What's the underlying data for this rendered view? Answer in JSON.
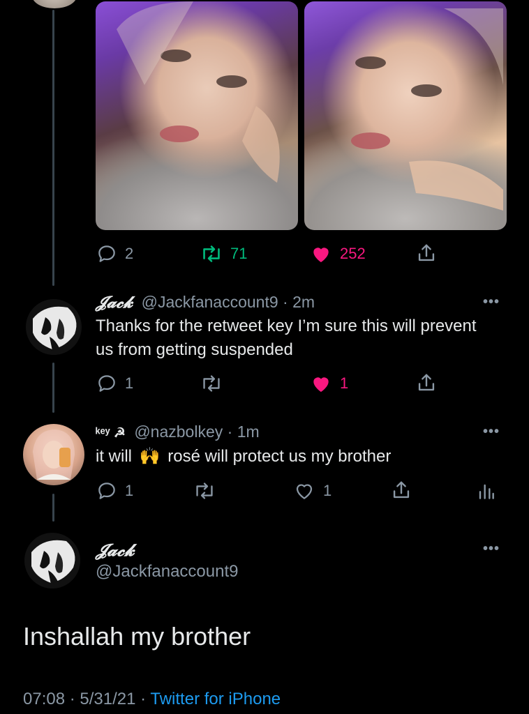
{
  "tweet1": {
    "reply_count": "2",
    "retweet_count": "71",
    "like_count": "252"
  },
  "reply1": {
    "display_name": "𝓙𝓪𝓬𝓴",
    "handle": "@Jackfanaccount9",
    "time": "· 2m",
    "text": "Thanks for the retweet key I’m sure this will prevent us from getting suspended",
    "reply_count": "1",
    "like_count": "1",
    "more": "•••"
  },
  "reply2": {
    "display_name": "ᵏᵉʸ ☭",
    "handle": "@nazbolkey",
    "time": "· 1m",
    "text_before": "it will",
    "emoji": "🙌",
    "text_after": "rosé will protect us my brother",
    "reply_count": "1",
    "like_count": "1",
    "more": "•••"
  },
  "main_tweet": {
    "display_name": "𝓙𝓪𝓬𝓴",
    "handle": "@Jackfanaccount9",
    "text": "Inshallah my brother",
    "time": "07:08",
    "date": "5/31/21",
    "source": "Twitter for iPhone",
    "more": "•••"
  },
  "colors": {
    "background": "#000000",
    "muted": "#8b98a5",
    "retweet_green": "#00ba7c",
    "like_red": "#f91880",
    "link_blue": "#1d9bf0",
    "thread_line": "#38444d"
  },
  "icons": [
    "reply-icon",
    "retweet-icon",
    "heart-icon",
    "share-icon",
    "analytics-icon"
  ]
}
